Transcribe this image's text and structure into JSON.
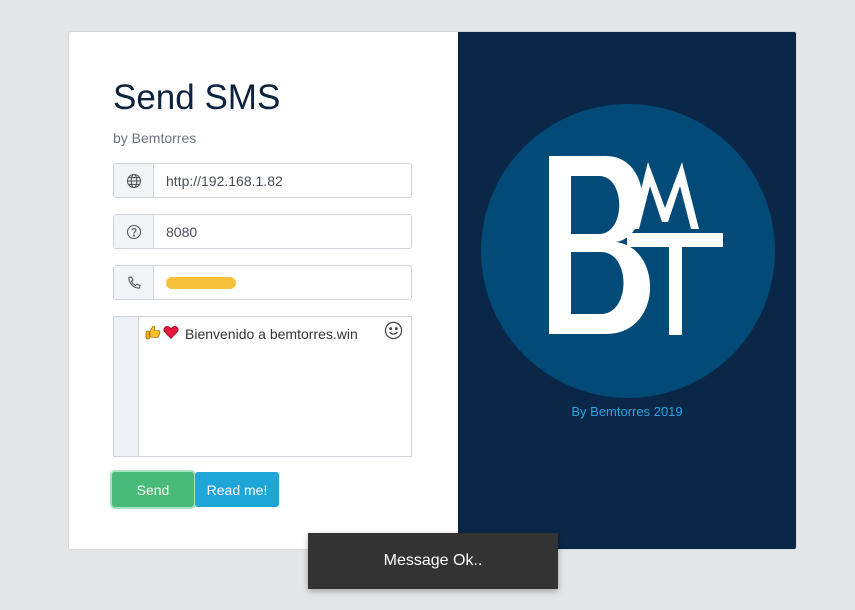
{
  "form": {
    "title": "Send SMS",
    "byline": "by Bemtorres",
    "url_field": {
      "value": "http://192.168.1.82",
      "icon": "globe-icon"
    },
    "port_field": {
      "value": "8080",
      "icon": "question-circle-icon"
    },
    "phone_field": {
      "value": "",
      "icon": "phone-icon"
    },
    "message": {
      "text": "Bienvenido a bemtorres.win",
      "emojis": [
        "thumbs-up",
        "red-heart"
      ]
    },
    "send_label": "Send",
    "readme_label": "Read me!"
  },
  "brand": {
    "logo_text": "BMT",
    "caption": "By Bemtorres 2019"
  },
  "toast": {
    "text": "Message Ok.."
  },
  "colors": {
    "panel_bg": "#0a2747",
    "circle": "#024a77",
    "send": "#48bb78",
    "readme": "#1fa6d9",
    "caption": "#27a5e3",
    "redaction": "#f7c13a"
  }
}
